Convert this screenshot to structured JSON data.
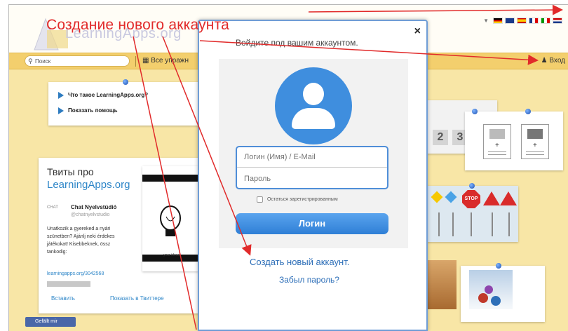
{
  "annotation": {
    "title": "Создание нового аккаунта",
    "color": "#e12a2a"
  },
  "header": {
    "logo_text": "LearningApps.org",
    "languages": [
      "de-flag-icon",
      "gb-flag-icon",
      "es-flag-icon",
      "fr-flag-icon",
      "it-flag-icon",
      "nl-flag-icon"
    ]
  },
  "navbar": {
    "search_placeholder": "Поиск",
    "all_exercises": "Все упражн",
    "login": "Вход"
  },
  "help": {
    "items": [
      {
        "label": "Что такое LearningApps.org?"
      },
      {
        "label": "Показать помощь"
      }
    ]
  },
  "tweets": {
    "title": "Твиты про",
    "title_link": "LearningApps.org",
    "avatar_text": "CHAT",
    "author": "Chat Nyelvstúdió",
    "handle": "@chatnyelvstudio",
    "body": "Unatkozik a gyereked a nyári\nszünetben? Ajánlj neki érdekes\njátékokat! Kisebbeknek, össz\ntankodig:",
    "link": "learningapps.org/3042568",
    "reply": "Вставить",
    "show_on_twitter": "Показать в Твиттере"
  },
  "idea_caption": "your ideas",
  "facebook_button": "Gefällt mir",
  "numbers": [
    "2",
    "3"
  ],
  "stop_sign": "STOP",
  "modal": {
    "subtitle": "Войдите под вашим аккаунтом.",
    "login_placeholder": "Логин (Имя) / E-Mail",
    "password_placeholder": "Пароль",
    "remember": "Остаться зарегистрированным",
    "login_button": "Логин",
    "create_account": "Создать новый аккаунт.",
    "forgot_password": "Забыл пароль?"
  },
  "colors": {
    "background": "#f8e6a6",
    "navbar": "#f3cf6d",
    "accent_blue": "#3f8ede",
    "link_blue": "#2e6fb8"
  }
}
